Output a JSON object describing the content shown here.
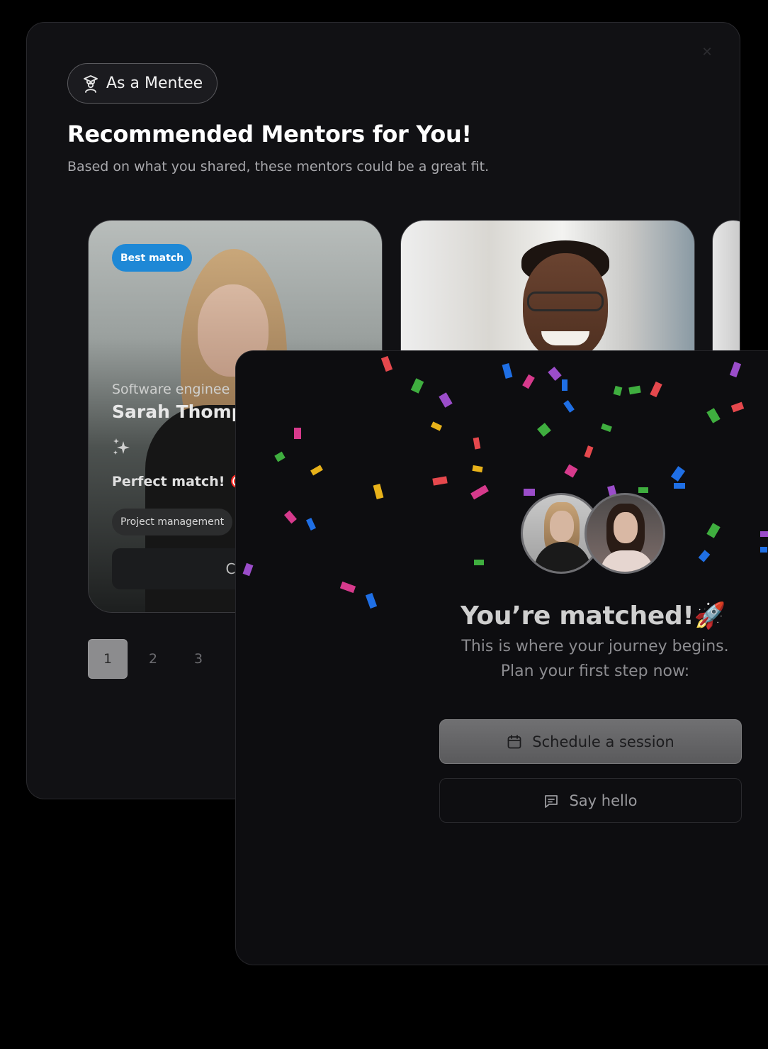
{
  "panel": {
    "role_pill": "As a Mentee",
    "title": "Recommended Mentors for You!",
    "subtitle": "Based on what you shared, these mentors could be a great fit.",
    "cards": [
      {
        "badge": "Best match",
        "role": "Software enginee",
        "name": "Sarah Thomp",
        "match": "Perfect match! 🎯",
        "tag": "Project management",
        "button": "Con"
      }
    ],
    "pages": [
      "1",
      "2",
      "3"
    ],
    "close_icon": "close-icon"
  },
  "modal": {
    "title": "You’re matched!🚀",
    "line1": "This is where your journey begins.",
    "line2": "Plan your first step now:",
    "schedule_button": "Schedule a session",
    "hello_button": "Say hello"
  },
  "colors": {
    "badge": "#1e88d6",
    "background": "#000000",
    "panel": "#111114"
  }
}
